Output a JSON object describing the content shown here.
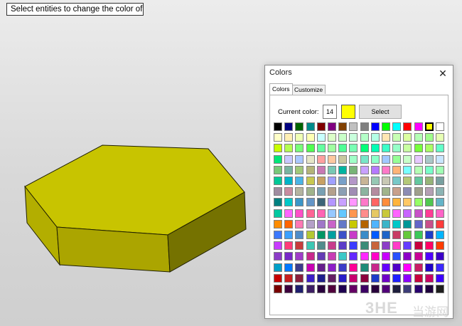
{
  "prompt": {
    "text": "Select entities to change the color of"
  },
  "viewport": {
    "object": "hexagonal-prism",
    "object_color": "#c8c400"
  },
  "dialog": {
    "title": "Colors",
    "tabs": [
      {
        "label": "Colors",
        "active": true
      },
      {
        "label": "Customize",
        "active": false
      }
    ],
    "current_color_label": "Current color:",
    "current_color_value": "14",
    "current_color_hex": "#ffff00",
    "select_label": "Select",
    "palette": [
      [
        "#000000",
        "#000080",
        "#006400",
        "#008b8b",
        "#800000",
        "#800080",
        "#804000",
        "#c0c0c0",
        "#808080",
        "#0000ff",
        "#00ff00",
        "#00ffff",
        "#ff0000",
        "#ff00ff",
        "#ffff00",
        "#ffffff"
      ],
      [
        "#ffffc8",
        "#fff0b4",
        "#f0ffb4",
        "#ffffb4",
        "#c8ffff",
        "#dcffc8",
        "#c8ffc8",
        "#c8ffdc",
        "#b4ffc8",
        "#b4ffe6",
        "#ffe6b4",
        "#c8ffb4",
        "#dcffa0",
        "#b4ffb4",
        "#a0ff8c",
        "#e6ffb4"
      ],
      [
        "#c8ff00",
        "#b4ff50",
        "#78ff78",
        "#50ff50",
        "#64ffa0",
        "#a0ffa0",
        "#50ff96",
        "#78ffb4",
        "#00ff78",
        "#00ffb4",
        "#3cffc8",
        "#96ffc8",
        "#c8ffa0",
        "#78ff3c",
        "#aaff64",
        "#64ffc8"
      ],
      [
        "#00e678",
        "#c8c8ff",
        "#aac8ff",
        "#e6e6c8",
        "#ffa0a0",
        "#ffc8a0",
        "#c8c8a0",
        "#a0ffc8",
        "#78e6c8",
        "#8cffc8",
        "#a0c8ff",
        "#96ff96",
        "#c8ffc8",
        "#e6c8ff",
        "#aac8c8",
        "#c8e6ff"
      ],
      [
        "#78c878",
        "#78b4a0",
        "#a0c878",
        "#b4b478",
        "#c878b4",
        "#78c8b4",
        "#00b4a0",
        "#78b478",
        "#c8a0ff",
        "#b478ff",
        "#ff78c8",
        "#ffb478",
        "#78ffff",
        "#b4ffb4",
        "#78ffc8",
        "#a0ffb4"
      ],
      [
        "#00c896",
        "#00b4c8",
        "#4ab4e6",
        "#c8c850",
        "#c8a064",
        "#a0a0ff",
        "#78a0c8",
        "#b496c8",
        "#c8b496",
        "#96c8b4",
        "#c8c8b4",
        "#78c8c8",
        "#b4c878",
        "#64c8a0",
        "#96b478",
        "#78a0a0"
      ],
      [
        "#a08ca0",
        "#c88ca0",
        "#b4b4a0",
        "#a0b48c",
        "#78a0b4",
        "#b4a08c",
        "#8ca0b4",
        "#a08cb4",
        "#8cb4a0",
        "#b48ca0",
        "#a0b48c",
        "#c8a08c",
        "#8c8cb4",
        "#a0a08c",
        "#b4a0b4",
        "#8cb4b4"
      ],
      [
        "#008080",
        "#00c8c8",
        "#3c96c8",
        "#6496c8",
        "#3c6478",
        "#b496ff",
        "#c8a0ff",
        "#ff96ff",
        "#ff78c8",
        "#ff6464",
        "#ff8c3c",
        "#ffb43c",
        "#ffc864",
        "#96ff64",
        "#50c850",
        "#64b4c8"
      ],
      [
        "#00c8a0",
        "#ff64ff",
        "#ff50c8",
        "#ff6496",
        "#ff64b4",
        "#96c8ff",
        "#64c8ff",
        "#ff9650",
        "#ff8c8c",
        "#e6c864",
        "#c8c83c",
        "#ff64ff",
        "#c864ff",
        "#c850c8",
        "#ff3c96",
        "#ff64c8"
      ],
      [
        "#ff8c00",
        "#ff6400",
        "#ff78b4",
        "#b4a0c8",
        "#a078c8",
        "#c864c8",
        "#6478c8",
        "#c8c800",
        "#b46400",
        "#50b4ff",
        "#3cb4c8",
        "#00c8c8",
        "#009696",
        "#6464c8",
        "#c8508c",
        "#ff3c3c"
      ],
      [
        "#3c78ff",
        "#3ca0ff",
        "#508cc8",
        "#b4c832",
        "#009664",
        "#00a0a0",
        "#3c50c8",
        "#c83cc8",
        "#3c8cc8",
        "#005aff",
        "#1e64c8",
        "#c83c64",
        "#64c83c",
        "#3cc85a",
        "#1e3cc8",
        "#00b4ff"
      ],
      [
        "#c83cff",
        "#ff3c78",
        "#c83c3c",
        "#3cc8b4",
        "#508c8c",
        "#c83c8c",
        "#5a3cc8",
        "#3c3cff",
        "#3c8c78",
        "#c8643c",
        "#8c3cc8",
        "#ff3cc8",
        "#643cff",
        "#c8003c",
        "#ff0064",
        "#ff3c00"
      ],
      [
        "#8c3cc8",
        "#7828c8",
        "#a03cc8",
        "#c8288c",
        "#643cb4",
        "#c83cb4",
        "#3cc8c8",
        "#6428ff",
        "#ff28ff",
        "#ff00c8",
        "#c800ff",
        "#2850ff",
        "#8c00c8",
        "#c80096",
        "#5000ff",
        "#3c00c8"
      ],
      [
        "#00a0c8",
        "#0078ff",
        "#3c3c8c",
        "#c800b4",
        "#641e8c",
        "#8c1ec8",
        "#3c3cc8",
        "#ff0096",
        "#1e8c78",
        "#c8288c",
        "#6400ff",
        "#5000c8",
        "#ff00ff",
        "#c81e64",
        "#1e00c8",
        "#3c28ff"
      ],
      [
        "#c80000",
        "#c81e1e",
        "#8c1e3c",
        "#3c1ec8",
        "#1e1e8c",
        "#641e64",
        "#281ec8",
        "#c8006e",
        "#8c003c",
        "#1e3cc8",
        "#6e00c8",
        "#1e1eff",
        "#8c00ff",
        "#c8003c",
        "#c80064",
        "#3c00ff"
      ],
      [
        "#780000",
        "#3c003c",
        "#1e1e6e",
        "#3c1e64",
        "#28003c",
        "#50003c",
        "#1e0050",
        "#640064",
        "#3c0064",
        "#28003c",
        "#500078",
        "#1e1e3c",
        "#3c3c78",
        "#28006e",
        "#1e003c",
        "#1e1e1e"
      ]
    ]
  },
  "watermark": {
    "logo": "3HE",
    "text": "当游网"
  }
}
